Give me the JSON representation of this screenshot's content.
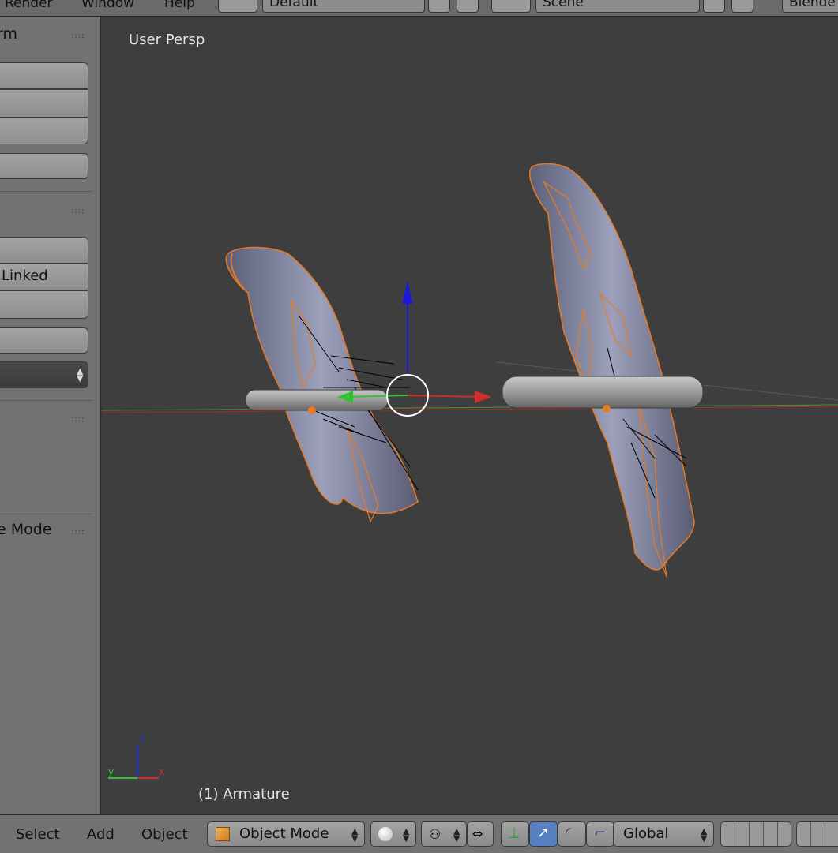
{
  "top_header": {
    "menus": [
      "Render",
      "Window",
      "Help"
    ],
    "screen_layout": "Default",
    "scene": "Scene",
    "engine": "Blende"
  },
  "tool_panel": {
    "section1_title": "rm",
    "section2_visible_label": "Linked",
    "section4_title": "e Mode"
  },
  "viewport": {
    "view_label": "User Persp",
    "object_label": "(1) Armature",
    "axis_labels": {
      "x": "x",
      "y": "y",
      "z": "z"
    }
  },
  "bottom_header": {
    "menus": [
      "Select",
      "Add",
      "Object"
    ],
    "mode": "Object Mode",
    "orientation": "Global"
  },
  "colors": {
    "selection_outline": "#e87b22",
    "axis_x": "#d42b2b",
    "axis_y": "#2fc42f",
    "axis_z": "#1a1ad8",
    "active_toggle": "#5680c2"
  },
  "icons": [
    "screen-layout-icon",
    "scene-icon",
    "add-icon",
    "close-icon",
    "object-mode-cube-icon",
    "viewport-shading-icon",
    "pivot-icon",
    "snap-icon",
    "manipulator-icon",
    "translate-icon",
    "rotate-icon",
    "scale-icon",
    "layers-icon"
  ]
}
